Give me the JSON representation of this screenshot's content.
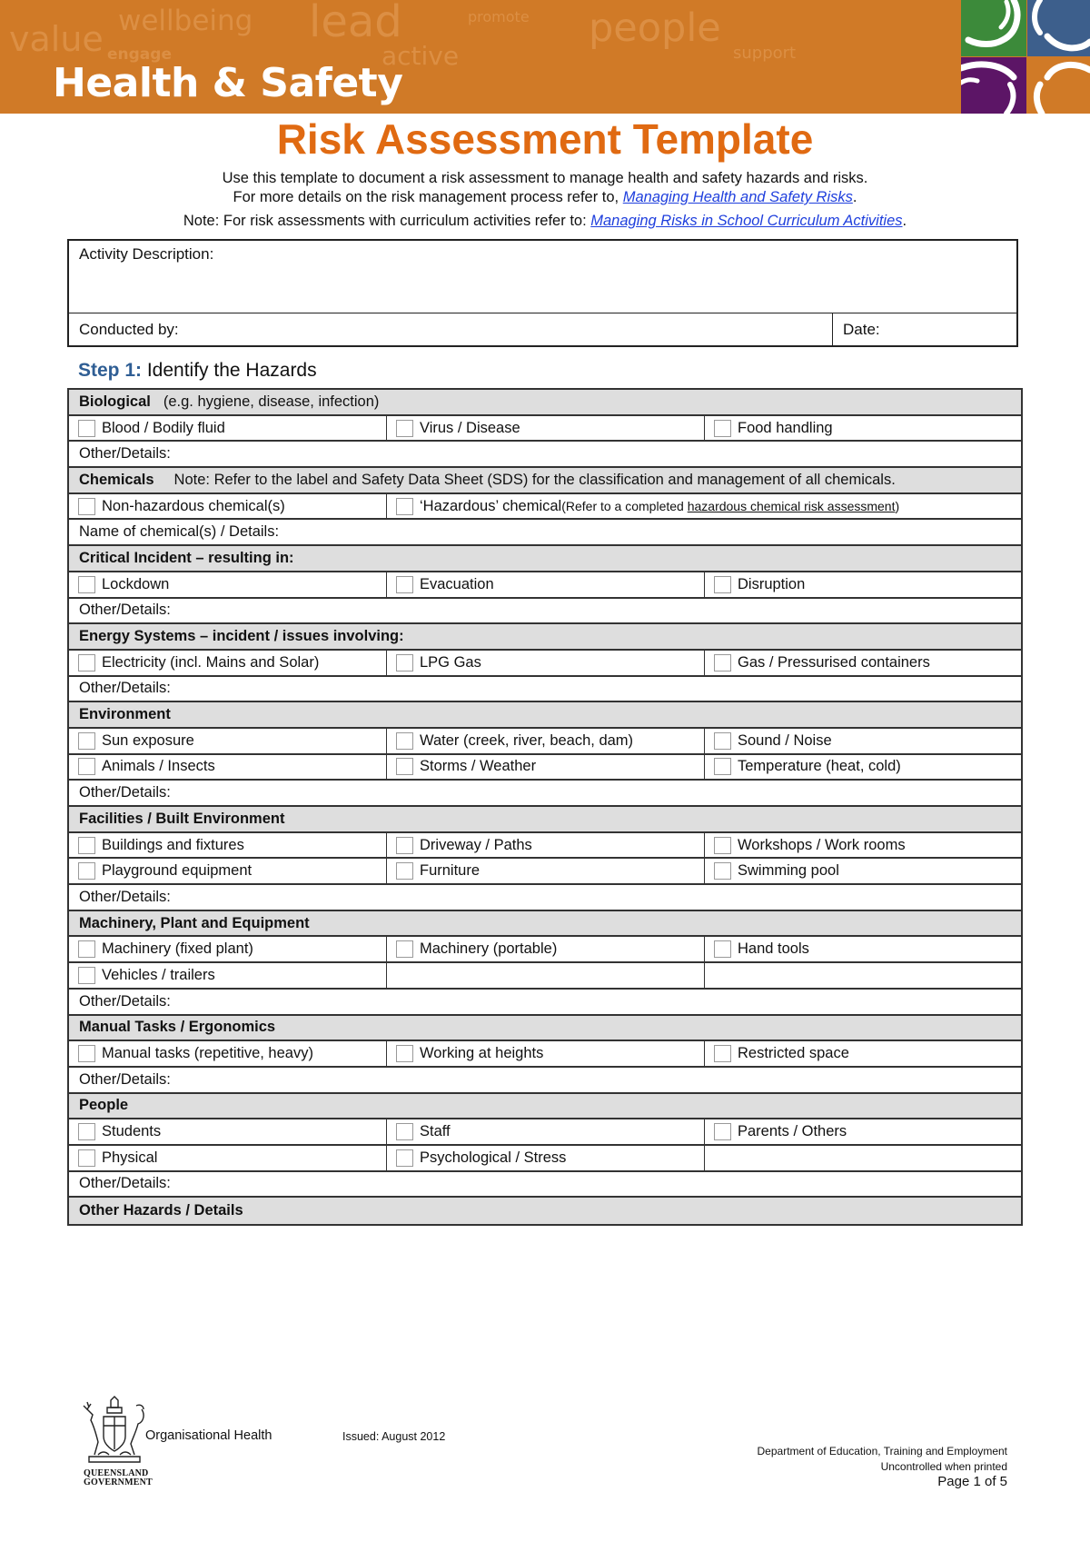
{
  "banner": {
    "title": "Health & Safety",
    "background_words": [
      "value",
      "wellbeing",
      "lead",
      "promote",
      "engage",
      "active",
      "people",
      "support"
    ],
    "colors": {
      "orange": "#d07a27",
      "green": "#3c8a3a",
      "blue": "#3d5f8c",
      "purple": "#5c1566"
    }
  },
  "document": {
    "title": "Risk Assessment Template",
    "intro_line1": "Use this template to document a risk assessment to manage health and safety hazards and risks.",
    "intro_line2_prefix": "For more details on the risk management process refer to, ",
    "intro_line2_link": "Managing Health and Safety Risks",
    "intro_line2_suffix": ".",
    "intro_line3_prefix": "Note: For risk assessments with curriculum activities refer to: ",
    "intro_line3_link": "Managing Risks in School Curriculum Activities",
    "intro_line3_suffix": "."
  },
  "activity": {
    "description_label": "Activity Description:",
    "description_value": "",
    "conducted_label": "Conducted by:",
    "conducted_value": "",
    "date_label": "Date:",
    "date_value": ""
  },
  "step1": {
    "step_label": "Step 1:",
    "heading": " Identify the Hazards"
  },
  "hazards": {
    "biological": {
      "title": "Biological",
      "note": "(e.g. hygiene, disease, infection)",
      "items": [
        "Blood / Bodily fluid",
        "Virus / Disease",
        "Food handling"
      ],
      "details_label": "Other/Details:"
    },
    "chemicals": {
      "title": "Chemicals",
      "note": "Note: Refer to the label and Safety Data Sheet (SDS) for the classification and management of all chemicals.",
      "item1": "Non-hazardous chemical(s)",
      "item2": "‘Hazardous’ chemical",
      "item2_note_prefix": " (Refer to a completed ",
      "item2_note_link": "hazardous chemical risk assessment",
      "item2_note_suffix": ")",
      "details_label": "Name of chemical(s) / Details:"
    },
    "critical_incident": {
      "title": "Critical Incident – resulting in:",
      "items": [
        "Lockdown",
        "Evacuation",
        "Disruption"
      ],
      "details_label": "Other/Details:"
    },
    "energy": {
      "title": "Energy Systems – incident / issues involving:",
      "items": [
        "Electricity (incl. Mains and Solar)",
        "LPG Gas",
        "Gas / Pressurised containers"
      ],
      "details_label": "Other/Details:"
    },
    "environment": {
      "title": "Environment",
      "row1": [
        "Sun exposure",
        "Water (creek, river, beach, dam)",
        "Sound / Noise"
      ],
      "row2": [
        "Animals / Insects",
        "Storms / Weather",
        "Temperature (heat, cold)"
      ],
      "details_label": "Other/Details:"
    },
    "facilities": {
      "title": "Facilities / Built Environment",
      "row1": [
        "Buildings and fixtures",
        "Driveway / Paths",
        "Workshops / Work rooms"
      ],
      "row2": [
        "Playground equipment",
        "Furniture",
        "Swimming pool"
      ],
      "details_label": "Other/Details:"
    },
    "machinery": {
      "title": "Machinery, Plant and Equipment",
      "row1": [
        "Machinery (fixed plant)",
        "Machinery (portable)",
        "Hand tools"
      ],
      "row2": [
        "Vehicles / trailers"
      ],
      "details_label": "Other/Details:"
    },
    "manual": {
      "title": "Manual Tasks / Ergonomics",
      "items": [
        "Manual tasks (repetitive, heavy)",
        "Working at heights",
        "Restricted space"
      ],
      "details_label": "Other/Details:"
    },
    "people": {
      "title": "People",
      "row1": [
        "Students",
        "Staff",
        "Parents / Others"
      ],
      "row2": [
        "Physical",
        "Psychological / Stress"
      ],
      "details_label": "Other/Details:"
    },
    "other": {
      "title": "Other Hazards / Details"
    }
  },
  "footer": {
    "crest_caption_line1": "QUEENSLAND",
    "crest_caption_line2": "GOVERNMENT",
    "org": "Organisational Health",
    "issued": "Issued: August 2012",
    "department": "Department of Education, Training and Employment",
    "uncontrolled": "Uncontrolled when printed",
    "page": "Page 1 of 5"
  }
}
